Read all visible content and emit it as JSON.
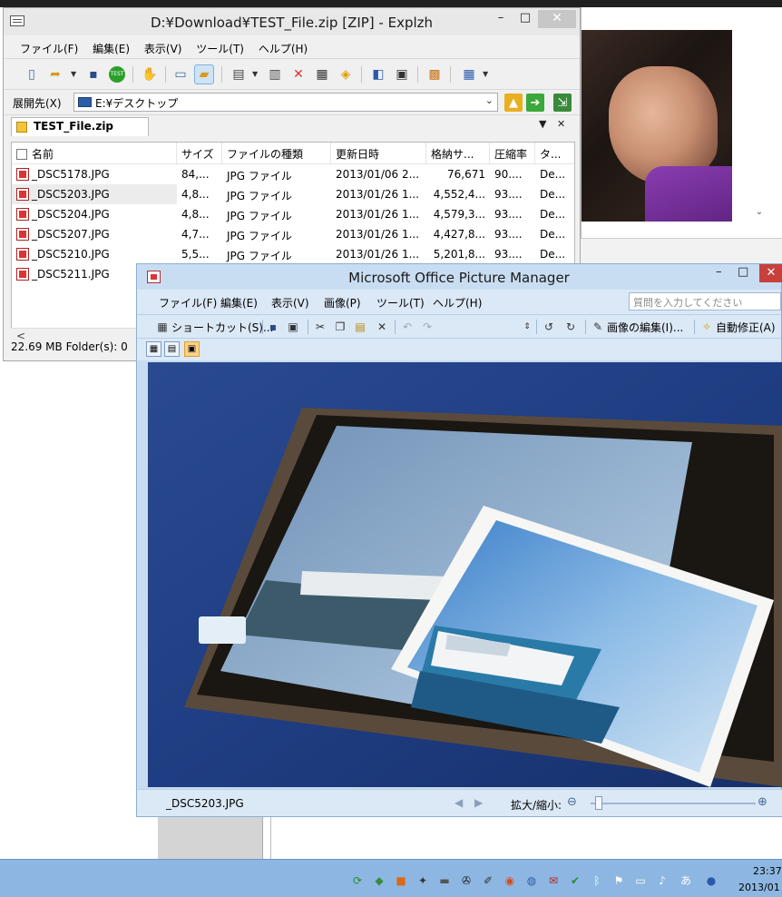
{
  "explzh": {
    "title": "D:¥Download¥TEST_File.zip [ZIP] - Explzh",
    "caption": {
      "minimize": "–",
      "maximize": "□",
      "close": "✕"
    },
    "menu": [
      "ファイル(F)",
      "編集(E)",
      "表示(V)",
      "ツール(T)",
      "ヘルプ(H)"
    ],
    "path_label": "展開先(X)",
    "path_value": "E:¥デスクトップ",
    "tab_label": "TEST_File.zip",
    "tab_controls": {
      "dropdown": "▼",
      "close": "✕"
    },
    "columns": [
      "名前",
      "サイズ",
      "ファイルの種類",
      "更新日時",
      "格納サ...",
      "圧縮率",
      "タ..."
    ],
    "rows": [
      {
        "name": "_DSC5178.JPG",
        "size": "84,...",
        "type": "JPG ファイル",
        "date": "2013/01/06 2...",
        "packed": "76,671",
        "ratio": "90....",
        "t": "De..."
      },
      {
        "name": "_DSC5203.JPG",
        "size": "4,8...",
        "type": "JPG ファイル",
        "date": "2013/01/26 1...",
        "packed": "4,552,4...",
        "ratio": "93....",
        "t": "De..."
      },
      {
        "name": "_DSC5204.JPG",
        "size": "4,8...",
        "type": "JPG ファイル",
        "date": "2013/01/26 1...",
        "packed": "4,579,3...",
        "ratio": "93....",
        "t": "De..."
      },
      {
        "name": "_DSC5207.JPG",
        "size": "4,7...",
        "type": "JPG ファイル",
        "date": "2013/01/26 1...",
        "packed": "4,427,8...",
        "ratio": "93....",
        "t": "De..."
      },
      {
        "name": "_DSC5210.JPG",
        "size": "5,5...",
        "type": "JPG ファイル",
        "date": "2013/01/26 1...",
        "packed": "5,201,8...",
        "ratio": "93....",
        "t": "De..."
      },
      {
        "name": "_DSC5211.JPG",
        "size": "",
        "type": "",
        "date": "",
        "packed": "",
        "ratio": "",
        "t": ""
      }
    ],
    "selected_row": 1,
    "scroll_left": "<",
    "status": "22.69 MB  Folder(s): 0"
  },
  "picture_manager": {
    "title": "Microsoft Office Picture Manager",
    "caption": {
      "minimize": "–",
      "maximize": "□",
      "close": "✕"
    },
    "menu": [
      "ファイル(F)",
      "編集(E)",
      "表示(V)",
      "画像(P)",
      "ツール(T)",
      "ヘルプ(H)"
    ],
    "ask_placeholder": "質問を入力してください",
    "toolbar": {
      "shortcut": "ショートカット(S)...",
      "edit_pictures": "画像の編集(I)...",
      "auto_correct": "自動修正(A)"
    },
    "filename": "_DSC5203.JPG",
    "zoom_label": "拡大/縮小:",
    "zoom_level": 0.03
  },
  "taskbar": {
    "time": "23:37",
    "date": "2013/01",
    "ime": "あ"
  },
  "colors": {
    "pm_chrome": "#dbe8f6",
    "pm_title": "#c9ddf2",
    "close_red": "#c7403c",
    "taskbar": "#8db7e2"
  }
}
